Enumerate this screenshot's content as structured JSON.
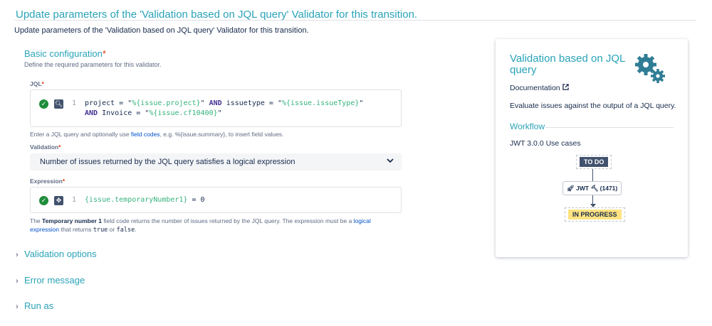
{
  "page": {
    "title": "Update parameters of the 'Validation based on JQL query' Validator for this transition.",
    "intro": "Update parameters of the 'Validation based on JQL query' Validator for this transition."
  },
  "basic": {
    "title": "Basic configuration",
    "required_mark": "*",
    "subtitle": "Define the required parameters for this validator."
  },
  "jql": {
    "label": "JQL",
    "required_mark": "*",
    "line_number": "1",
    "line1": [
      {
        "t": "project = ",
        "c": "plain"
      },
      {
        "t": "\"",
        "c": "str"
      },
      {
        "t": "%{issue.project}",
        "c": "fld"
      },
      {
        "t": "\"",
        "c": "str"
      },
      {
        "t": " AND ",
        "c": "kw"
      },
      {
        "t": "issuetype = ",
        "c": "plain"
      },
      {
        "t": "\"",
        "c": "str"
      },
      {
        "t": "%{issue.issueType}",
        "c": "fld"
      },
      {
        "t": "\"",
        "c": "str"
      }
    ],
    "line2": [
      {
        "t": "AND ",
        "c": "kw"
      },
      {
        "t": "Invoice = ",
        "c": "plain"
      },
      {
        "t": "\"",
        "c": "str"
      },
      {
        "t": "%{issue.cf10400}",
        "c": "fld"
      },
      {
        "t": "\"",
        "c": "str"
      }
    ],
    "help_prefix": "Enter a JQL query and optionally use ",
    "help_link": "field codes",
    "help_suffix": ", e.g. %{issue.summary}, to insert field values."
  },
  "validation": {
    "label": "Validation",
    "required_mark": "*",
    "selected": "Number of issues returned by the JQL query satisfies a logical expression"
  },
  "expression": {
    "label": "Expression",
    "required_mark": "*",
    "line_number": "1",
    "code_field": "{issue.temporaryNumber1}",
    "code_rest": " = 0",
    "help_1": "The ",
    "help_bold": "Temporary number 1",
    "help_2": " field code returns the number of issues returned by the JQL query. The expression must be a ",
    "help_link": "logical expression",
    "help_3": " that returns ",
    "help_true": "true",
    "help_4": " or ",
    "help_false": "false",
    "help_5": "."
  },
  "sections": {
    "validation_options": "Validation options",
    "error_message": "Error message",
    "run_as": "Run as"
  },
  "card": {
    "title": "Validation based on JQL query",
    "doc_label": "Documentation",
    "description": "Evaluate issues against the output of a JQL query.",
    "workflow_title": "Workflow",
    "workflow_sub": "JWT 3.0.0 Use cases",
    "status_from": "TO DO",
    "transition_label": "JWT",
    "transition_count": "(1471)",
    "status_to": "IN PROGRESS"
  },
  "colors": {
    "accent": "#2aa3b8",
    "required": "#de350b",
    "ok": "#1e8c3a",
    "todo_bg": "#42526e",
    "inprogress_bg": "#ffe380"
  },
  "icons": {
    "valid": "check-circle-icon",
    "jql_tool": "search-icon",
    "expr_tool": "expression-icon",
    "select": "chevron-down-icon",
    "collapsed": "chevron-right-icon",
    "external": "external-link-icon",
    "brand": "gears-icon"
  }
}
